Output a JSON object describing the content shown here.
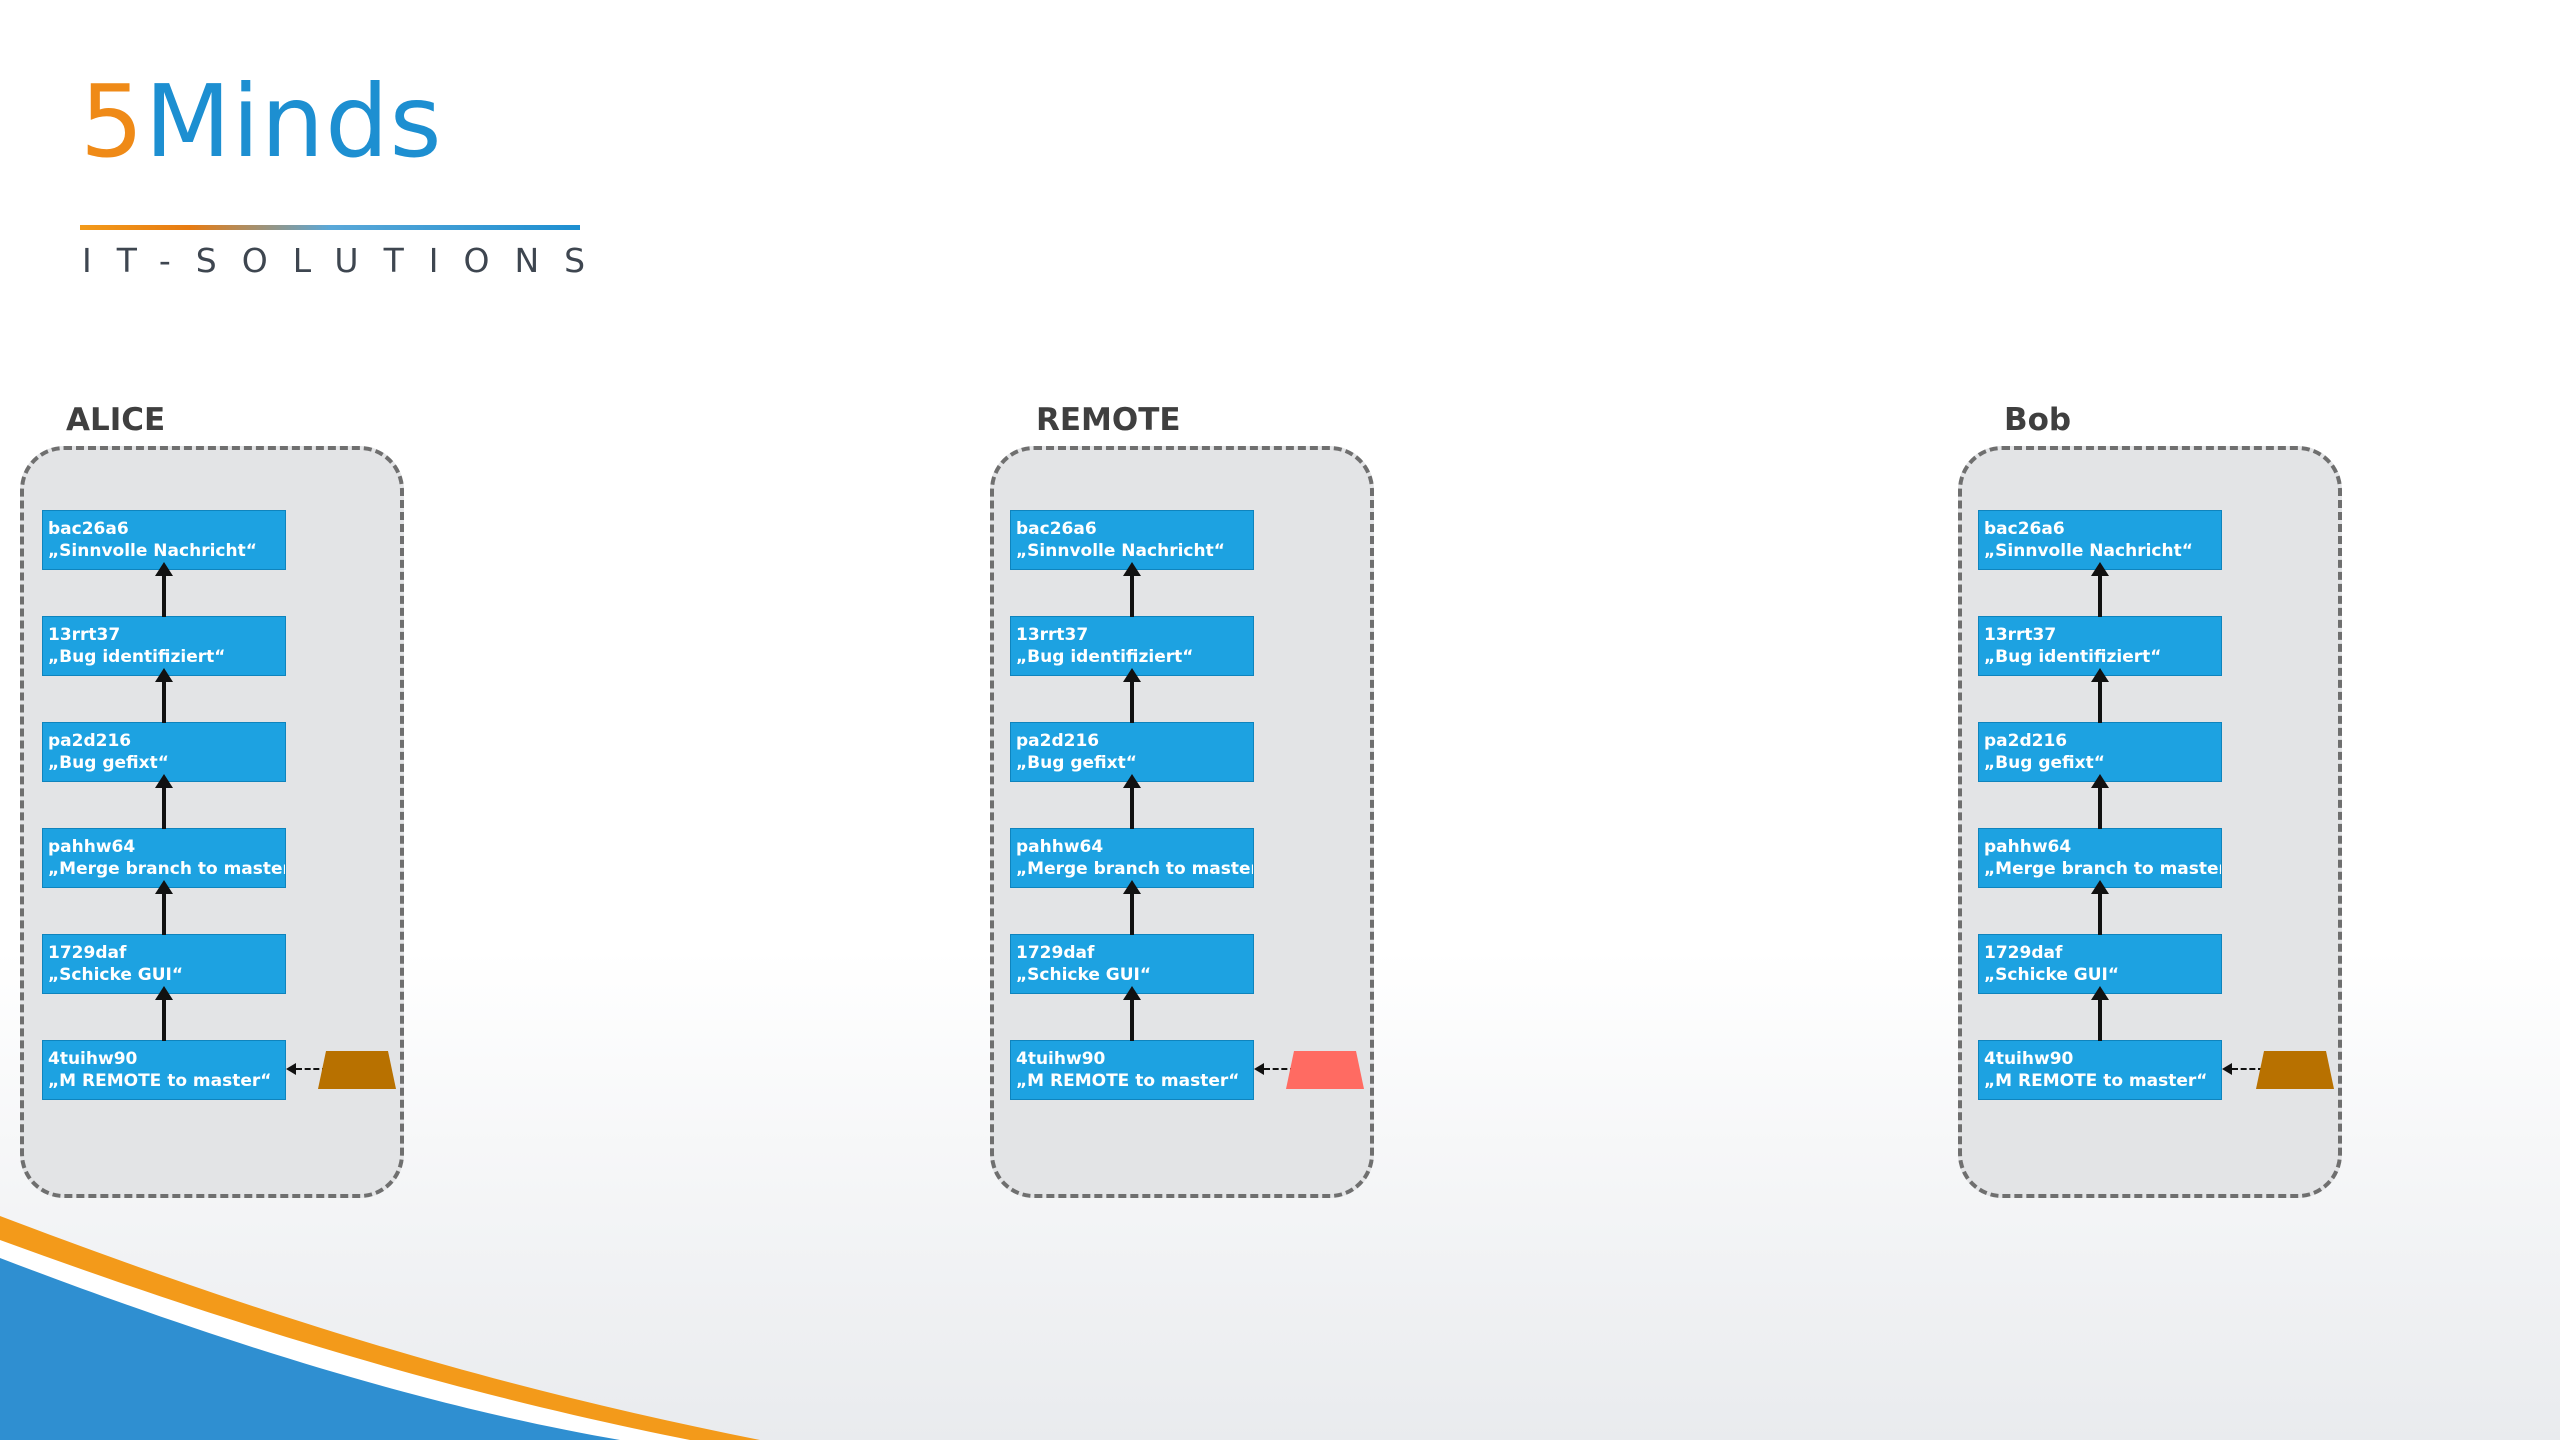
{
  "logo": {
    "number": "5",
    "word": "Minds",
    "subtitle": "IT-SOLUTIONS",
    "colors": {
      "orange": "#ef8a17",
      "blue": "#1d8fd1"
    }
  },
  "colors": {
    "commit_fill": "#1da2e1",
    "panel_fill": "#e3e4e6",
    "panel_border": "#6f6f6f",
    "local_branch": "#b87100",
    "remote_branch": "#ff6b62"
  },
  "groups": [
    {
      "title": "ALICE",
      "branch_color": "#b87100",
      "commits": [
        {
          "hash": "bac26a6",
          "message": "„Sinnvolle Nachricht“"
        },
        {
          "hash": "13rrt37",
          "message": "„Bug identifiziert“"
        },
        {
          "hash": "pa2d216",
          "message": "„Bug gefixt“"
        },
        {
          "hash": "pahhw64",
          "message": "„Merge branch to master“"
        },
        {
          "hash": "1729daf",
          "message": "„Schicke GUI“"
        },
        {
          "hash": "4tuihw90",
          "message": "„M REMOTE to master“"
        }
      ]
    },
    {
      "title": "REMOTE",
      "branch_color": "#ff6b62",
      "commits": [
        {
          "hash": "bac26a6",
          "message": "„Sinnvolle Nachricht“"
        },
        {
          "hash": "13rrt37",
          "message": "„Bug identifiziert“"
        },
        {
          "hash": "pa2d216",
          "message": "„Bug gefixt“"
        },
        {
          "hash": "pahhw64",
          "message": "„Merge branch to master“"
        },
        {
          "hash": "1729daf",
          "message": "„Schicke GUI“"
        },
        {
          "hash": "4tuihw90",
          "message": "„M REMOTE to master“"
        }
      ]
    },
    {
      "title": "Bob",
      "branch_color": "#b87100",
      "commits": [
        {
          "hash": "bac26a6",
          "message": "„Sinnvolle Nachricht“"
        },
        {
          "hash": "13rrt37",
          "message": "„Bug identifiziert“"
        },
        {
          "hash": "pa2d216",
          "message": "„Bug gefixt“"
        },
        {
          "hash": "pahhw64",
          "message": "„Merge branch to master“"
        },
        {
          "hash": "1729daf",
          "message": "„Schicke GUI“"
        },
        {
          "hash": "4tuihw90",
          "message": "„M REMOTE to master“"
        }
      ]
    }
  ]
}
